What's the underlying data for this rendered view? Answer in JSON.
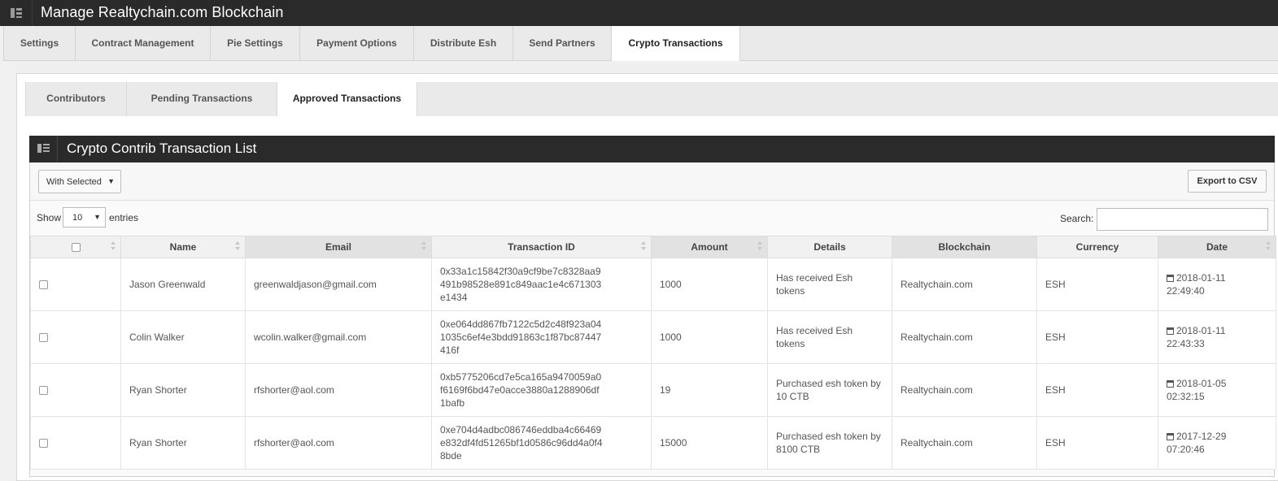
{
  "app": {
    "title": "Manage Realtychain.com Blockchain"
  },
  "main_tabs": [
    {
      "label": "Settings"
    },
    {
      "label": "Contract Management"
    },
    {
      "label": "Pie Settings"
    },
    {
      "label": "Payment Options"
    },
    {
      "label": "Distribute Esh"
    },
    {
      "label": "Send Partners"
    },
    {
      "label": "Crypto Transactions",
      "active": true
    }
  ],
  "sub_tabs": [
    {
      "label": "Contributors"
    },
    {
      "label": "Pending Transactions"
    },
    {
      "label": "Approved Transactions",
      "active": true
    }
  ],
  "panel": {
    "title": "Crypto Contrib Transaction List",
    "with_selected": "With Selected",
    "export_label": "Export to CSV",
    "show_label": "Show",
    "entries_value": "10",
    "entries_label": "entries",
    "search_label": "Search:",
    "search_value": ""
  },
  "table": {
    "columns": [
      "",
      "Name",
      "Email",
      "Transaction ID",
      "Amount",
      "Details",
      "Blockchain",
      "Currency",
      "Date"
    ],
    "rows": [
      {
        "name": "Jason Greenwald",
        "email": "greenwaldjason@gmail.com",
        "tx": [
          "0x33a1c15842f30a9cf9be7c8328aa9",
          "491b98528e891c849aac1e4c671303",
          "e1434"
        ],
        "amount": "1000",
        "details": [
          "Has received Esh",
          "tokens"
        ],
        "blockchain": "Realtychain.com",
        "currency": "ESH",
        "date": "2018-01-11",
        "time": "22:49:40"
      },
      {
        "name": "Colin Walker",
        "email": "wcolin.walker@gmail.com",
        "tx": [
          "0xe064dd867fb7122c5d2c48f923a04",
          "1035c6ef4e3bdd91863c1f87bc87447",
          "416f"
        ],
        "amount": "1000",
        "details": [
          "Has received Esh",
          "tokens"
        ],
        "blockchain": "Realtychain.com",
        "currency": "ESH",
        "date": "2018-01-11",
        "time": "22:43:33"
      },
      {
        "name": "Ryan Shorter",
        "email": "rfshorter@aol.com",
        "tx": [
          "0xb5775206cd7e5ca165a9470059a0",
          "f6169f6bd47e0acce3880a1288906df",
          "1bafb"
        ],
        "amount": "19",
        "details": [
          "Purchased esh token by",
          "10 CTB"
        ],
        "blockchain": "Realtychain.com",
        "currency": "ESH",
        "date": "2018-01-05",
        "time": "02:32:15"
      },
      {
        "name": "Ryan Shorter",
        "email": "rfshorter@aol.com",
        "tx": [
          "0xe704d4adbc086746eddba4c66469",
          "e832df4fd51265bf1d0586c96dd4a0f4",
          "8bde"
        ],
        "amount": "15000",
        "details": [
          "Purchased esh token by",
          "8100 CTB"
        ],
        "blockchain": "Realtychain.com",
        "currency": "ESH",
        "date": "2017-12-29",
        "time": "07:20:46"
      }
    ]
  }
}
